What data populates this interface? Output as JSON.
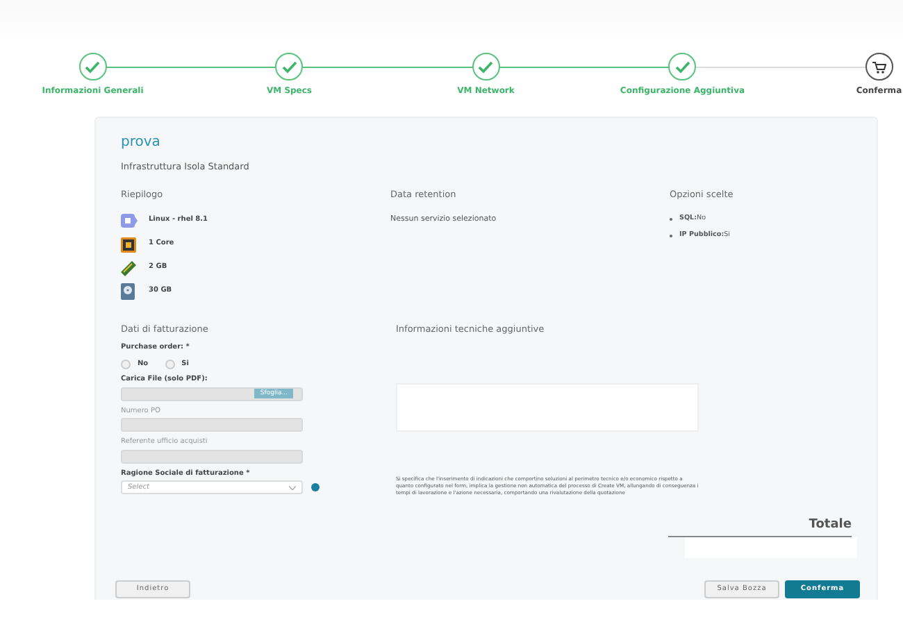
{
  "steps": [
    {
      "label": "Informazioni Generali",
      "done": true
    },
    {
      "label": "VM Specs",
      "done": true
    },
    {
      "label": "VM Network",
      "done": true
    },
    {
      "label": "Configurazione Aggiuntiva",
      "done": true
    },
    {
      "label": "Conferma",
      "done": false
    }
  ],
  "title": "prova",
  "subtitle": "Infrastruttura Isola Standard",
  "summary": {
    "heading": "Riepilogo",
    "items": [
      {
        "kind": "os",
        "text": "Linux - rhel 8.1"
      },
      {
        "kind": "cpu",
        "text": "1 Core"
      },
      {
        "kind": "ram",
        "text": "2 GB"
      },
      {
        "kind": "disk",
        "text": "30 GB"
      }
    ]
  },
  "retention": {
    "heading": "Data retention",
    "text": "Nessun servizio selezionato"
  },
  "options": {
    "heading": "Opzioni scelte",
    "items": [
      {
        "label": "SQL:",
        "value": "No"
      },
      {
        "label": "IP Pubblico:",
        "value": "Si"
      }
    ]
  },
  "billing": {
    "heading": "Dati di fatturazione",
    "purchase_order": {
      "label": "Purchase order:",
      "required_mark": "*",
      "choices": [
        {
          "label": "No",
          "selected": false
        },
        {
          "label": "Si",
          "selected": false
        }
      ]
    },
    "fields": [
      {
        "kind": "file",
        "label": "Carica File (solo PDF):",
        "button": "Sfoglia...",
        "disabled": false
      },
      {
        "kind": "text",
        "label": "Numero PO",
        "disabled": true
      },
      {
        "kind": "text",
        "label": "Referente ufficio acquisti",
        "disabled": true
      },
      {
        "kind": "select",
        "label": "Ragione Sociale di fatturazione",
        "required_mark": "*",
        "placeholder": "Select",
        "disabled": false
      }
    ]
  },
  "tech_info": {
    "heading": "Informazioni tecniche aggiuntive",
    "note": "Si specifica che l'inserimento di indicazioni che comportino soluzioni al perimetro tecnico e/o economico rispetto a quanto configurato nel form, implica la gestione non automatica del processo di Create VM, allungando di conseguenza i tempi di lavorazione e l'azione necessaria, comportando una rivalutazione della quotazione"
  },
  "total": {
    "label": "Totale"
  },
  "buttons": [
    {
      "kind": "secondary",
      "label": "Indietro"
    },
    {
      "kind": "secondary",
      "label": "Salva Bozza"
    },
    {
      "kind": "primary",
      "label": "Conferma"
    }
  ]
}
